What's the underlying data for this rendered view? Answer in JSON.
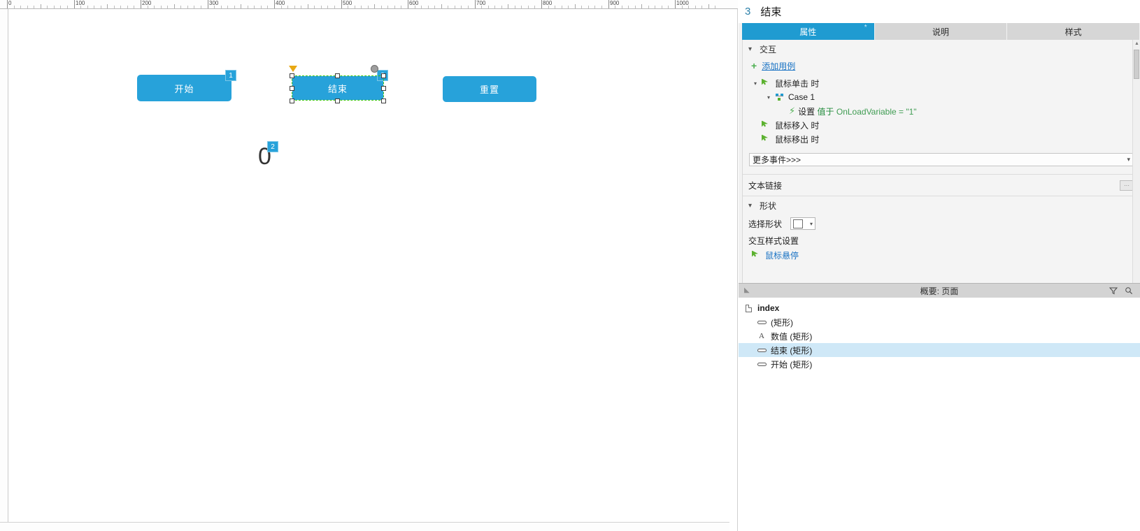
{
  "canvas": {
    "ruler_labels": [
      "0",
      "100",
      "200",
      "300",
      "400",
      "500",
      "600",
      "700",
      "800",
      "900",
      "1000"
    ],
    "widgets": [
      {
        "label": "开始",
        "badge": "1"
      },
      {
        "label": "结束",
        "badge": "3"
      },
      {
        "label": "重置",
        "badge": null
      }
    ],
    "value_display": {
      "text": "0",
      "badge": "2"
    }
  },
  "inspector": {
    "index": "3",
    "name": "结束",
    "tabs": [
      {
        "label": "属性",
        "active": true,
        "marker": "*"
      },
      {
        "label": "说明",
        "active": false
      },
      {
        "label": "样式",
        "active": false
      }
    ],
    "interaction_section": "交互",
    "add_case_label": "添加用例",
    "events": [
      {
        "label": "鼠标单击 时",
        "icon": "mouse-event-icon",
        "level": 0,
        "expanded": true
      },
      {
        "label": "Case 1",
        "icon": "case-icon",
        "level": 1,
        "expanded": true
      },
      {
        "label_prefix": "设置",
        "label_mid": "值于",
        "label_var": "OnLoadVariable = \"1\"",
        "icon": "bolt-icon",
        "level": 2
      },
      {
        "label": "鼠标移入 时",
        "icon": "mouse-event-icon",
        "level": 0
      },
      {
        "label": "鼠标移出 时",
        "icon": "mouse-event-icon",
        "level": 0
      }
    ],
    "more_events_label": "更多事件>>>",
    "text_link_label": "文本链接",
    "text_link_button": "···",
    "shape_section": "形状",
    "select_shape_label": "选择形状",
    "interaction_style_label": "交互样式设置",
    "mouse_hover_label": "鼠标悬停"
  },
  "outline": {
    "header_title": "概要: 页面",
    "filter_icon": "filter-icon",
    "search_icon": "search-icon",
    "rows": [
      {
        "label": "index",
        "icon": "page-icon",
        "indent": 0,
        "selected": false,
        "bold": true
      },
      {
        "label": "(矩形)",
        "icon": "rect-icon",
        "indent": 1,
        "selected": false,
        "bold": false
      },
      {
        "label": "数值 (矩形)",
        "icon": "text-icon",
        "indent": 1,
        "selected": false,
        "bold": false
      },
      {
        "label": "结束 (矩形)",
        "icon": "rect-icon",
        "indent": 1,
        "selected": true,
        "bold": false
      },
      {
        "label": "开始 (矩形)",
        "icon": "rect-icon",
        "indent": 1,
        "selected": false,
        "bold": false
      }
    ]
  },
  "colors": {
    "accent": "#27a2da",
    "tab_active": "#1f9bd1",
    "selection_border": "#3ec70b",
    "link": "#1a73c4",
    "row_selected": "#cfe8f7"
  }
}
